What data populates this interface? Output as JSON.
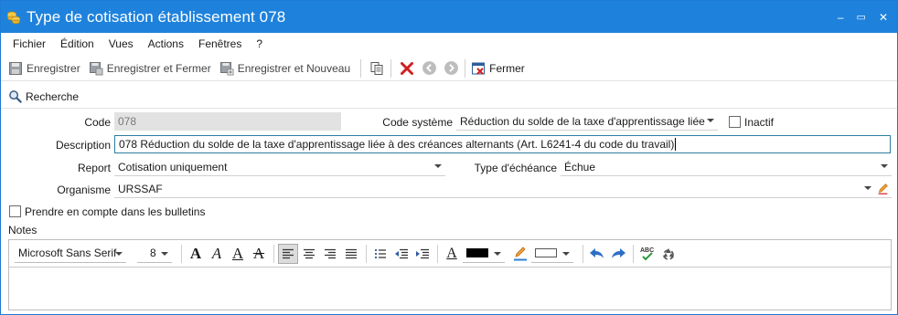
{
  "window": {
    "title": "Type de cotisation établissement 078",
    "controls": [
      "–",
      "▭",
      "✕"
    ]
  },
  "menu": [
    "Fichier",
    "Édition",
    "Vues",
    "Actions",
    "Fenêtres",
    "?"
  ],
  "toolbar": {
    "save": "Enregistrer",
    "save_close": "Enregistrer et Fermer",
    "save_new": "Enregistrer et Nouveau",
    "close": "Fermer"
  },
  "search_tab": "Recherche",
  "form": {
    "code_label": "Code",
    "code_value": "078",
    "code_systeme_label": "Code système",
    "code_systeme_value": "Réduction du solde de la taxe d'apprentissage liée à de",
    "inactif_label": "Inactif",
    "inactif_checked": false,
    "description_label": "Description",
    "description_value": "078 Réduction du solde de la taxe d'apprentissage liée à des créances alternants (Art. L6241-4 du code du travail)",
    "report_label": "Report",
    "report_value": "Cotisation uniquement",
    "type_echeance_label": "Type d'échéance",
    "type_echeance_value": "Échue",
    "organisme_label": "Organisme",
    "organisme_value": "URSSAF",
    "bulletins_label": "Prendre en compte dans les bulletins",
    "bulletins_checked": false,
    "notes_label": "Notes",
    "notes_value": ""
  },
  "editor": {
    "font": "Microsoft Sans Serif",
    "size": "8",
    "text_color": "#000000",
    "highlight_color": "#ffffff"
  }
}
